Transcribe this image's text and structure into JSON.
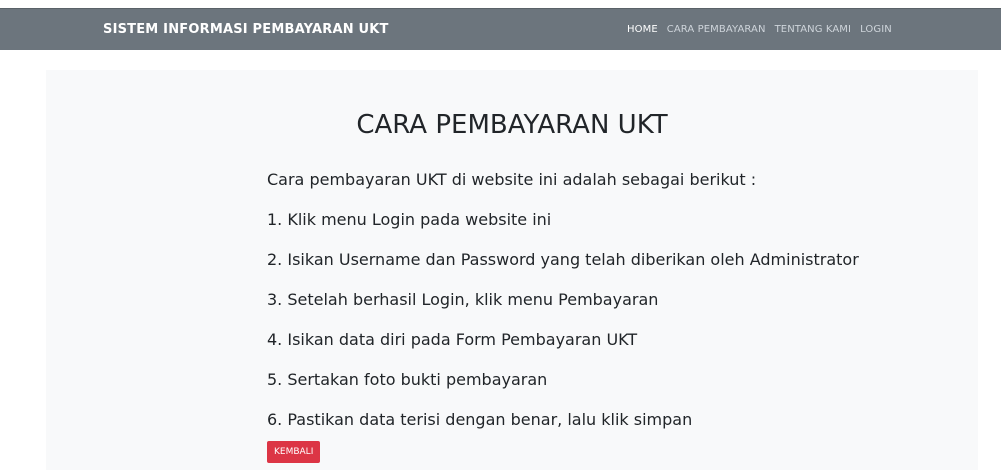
{
  "navbar": {
    "brand": "SISTEM INFORMASI PEMBAYARAN UKT",
    "links": [
      {
        "label": "HOME",
        "active": true
      },
      {
        "label": "CARA PEMBAYARAN",
        "active": false
      },
      {
        "label": "TENTANG KAMI",
        "active": false
      },
      {
        "label": "LOGIN",
        "active": false
      }
    ]
  },
  "main": {
    "title": "CARA PEMBAYARAN UKT",
    "intro": "Cara pembayaran UKT di website ini adalah sebagai berikut :",
    "steps": [
      "1. Klik menu Login pada website ini",
      "2. Isikan Username dan Password yang telah diberikan oleh Administrator",
      "3. Setelah berhasil Login, klik menu Pembayaran",
      "4. Isikan data diri pada Form Pembayaran UKT",
      "5. Sertakan foto bukti pembayaran",
      "6. Pastikan data terisi dengan benar, lalu klik simpan"
    ],
    "back_label": "KEMBALI"
  },
  "colors": {
    "navbar": "#6c757d",
    "card": "#f8f9fa",
    "button": "#dc3545",
    "text": "#212529"
  }
}
